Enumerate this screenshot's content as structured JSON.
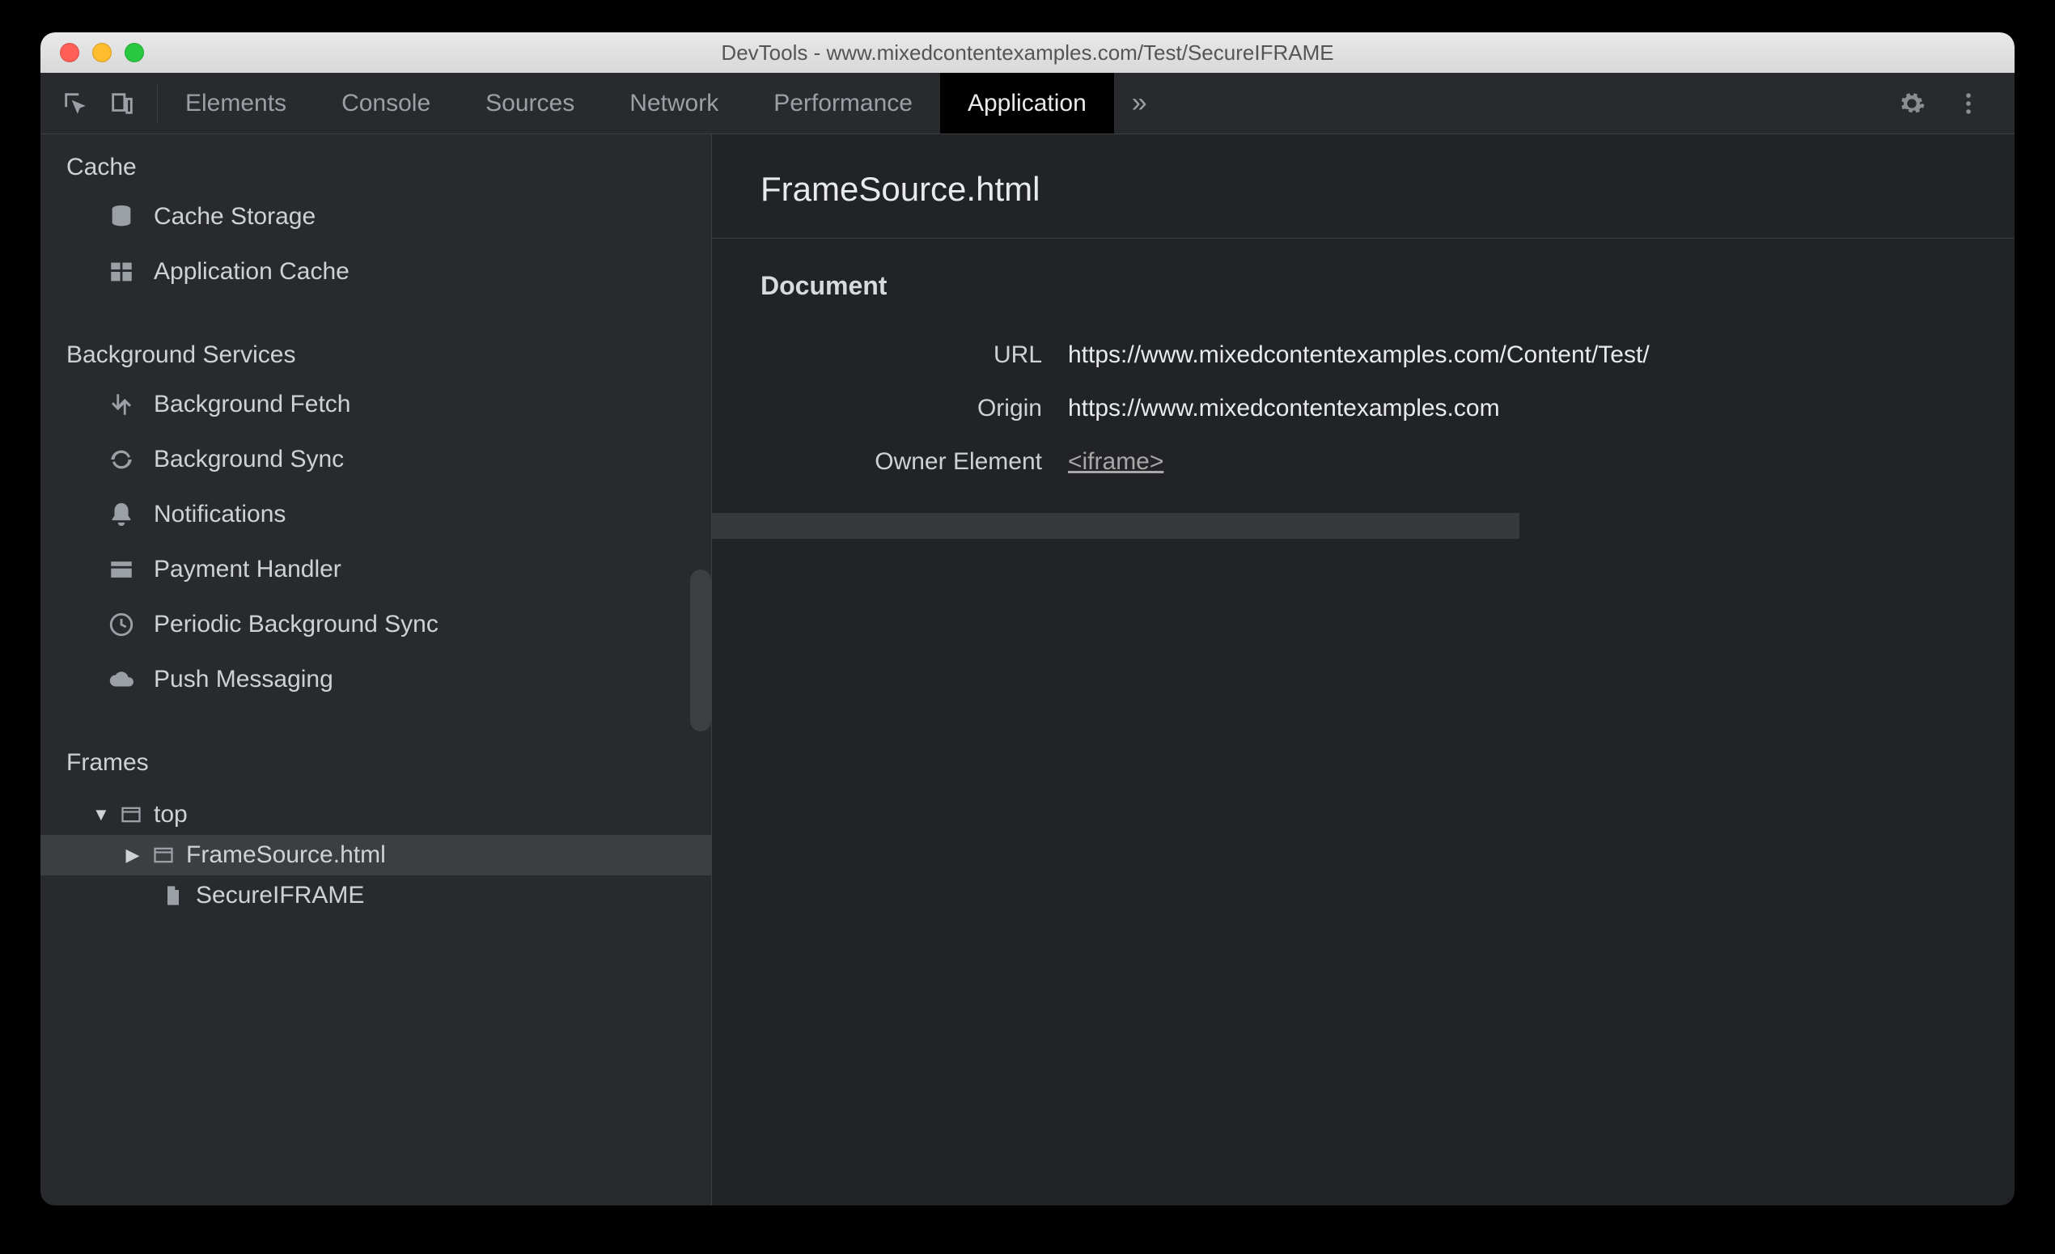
{
  "window": {
    "title": "DevTools - www.mixedcontentexamples.com/Test/SecureIFRAME"
  },
  "toolbar": {
    "tabs": [
      {
        "label": "Elements"
      },
      {
        "label": "Console"
      },
      {
        "label": "Sources"
      },
      {
        "label": "Network"
      },
      {
        "label": "Performance"
      },
      {
        "label": "Application"
      }
    ],
    "active_tab": "Application"
  },
  "sidebar": {
    "sections": [
      {
        "title": "Cache",
        "items": [
          {
            "icon": "database-icon",
            "label": "Cache Storage"
          },
          {
            "icon": "grid-icon",
            "label": "Application Cache"
          }
        ]
      },
      {
        "title": "Background Services",
        "items": [
          {
            "icon": "transfer-icon",
            "label": "Background Fetch"
          },
          {
            "icon": "sync-icon",
            "label": "Background Sync"
          },
          {
            "icon": "bell-icon",
            "label": "Notifications"
          },
          {
            "icon": "card-icon",
            "label": "Payment Handler"
          },
          {
            "icon": "clock-icon",
            "label": "Periodic Background Sync"
          },
          {
            "icon": "cloud-icon",
            "label": "Push Messaging"
          }
        ]
      },
      {
        "title": "Frames",
        "items": []
      }
    ],
    "frames_tree": {
      "root": {
        "label": "top",
        "expanded": true,
        "icon": "window-icon"
      },
      "children": [
        {
          "label": "FrameSource.html",
          "expanded": false,
          "selected": true,
          "icon": "window-icon"
        },
        {
          "label": "SecureIFRAME",
          "icon": "file-icon",
          "leaf": true
        }
      ]
    }
  },
  "main": {
    "title": "FrameSource.html",
    "section_heading": "Document",
    "rows": [
      {
        "label": "URL",
        "value": "https://www.mixedcontentexamples.com/Content/Test/",
        "type": "text"
      },
      {
        "label": "Origin",
        "value": "https://www.mixedcontentexamples.com",
        "type": "text"
      },
      {
        "label": "Owner Element",
        "value": "<iframe>",
        "type": "link"
      }
    ]
  }
}
